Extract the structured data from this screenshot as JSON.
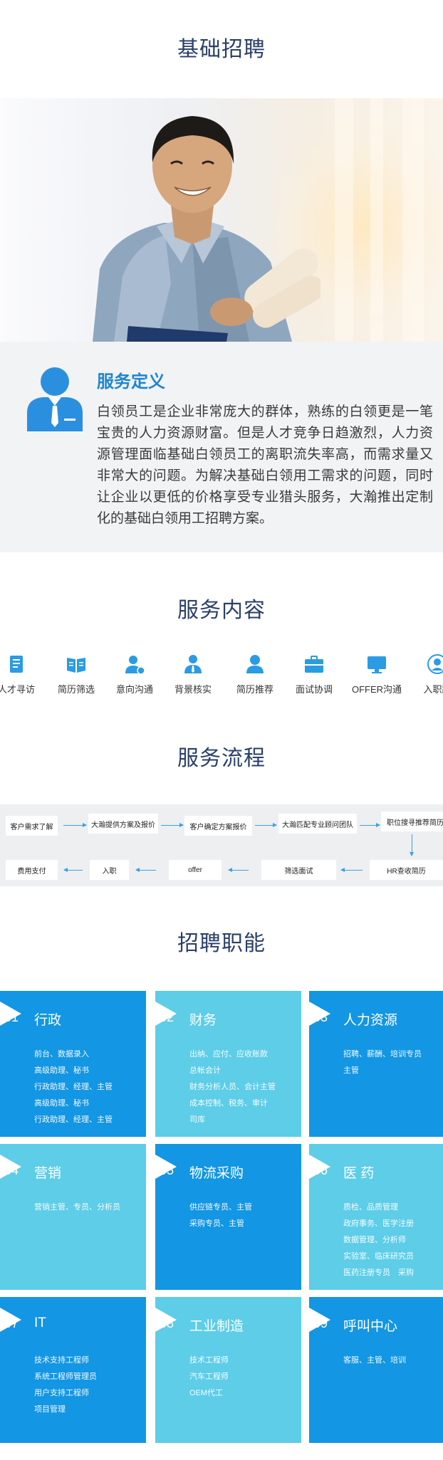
{
  "titles": {
    "basic_recruit": "基础招聘",
    "service_content": "服务内容",
    "service_process": "服务流程",
    "recruit_functions": "招聘职能"
  },
  "definition": {
    "title": "服务定义",
    "text": "白领员工是企业非常庞大的群体，熟练的白领更是一笔宝贵的人力资源财富。但是人才竞争日趋激烈，人力资源管理面临基础白领员工的离职流失率高，而需求量又非常大的问题。为解决基础白领用工需求的问题，同时让企业以更低的价格享受专业猎头服务，大瀚推出定制化的基础白领用工招聘方案。"
  },
  "services": [
    {
      "label": "人才寻访",
      "icon": "document-icon"
    },
    {
      "label": "简历筛选",
      "icon": "book-icon"
    },
    {
      "label": "意向沟通",
      "icon": "user-chat-icon"
    },
    {
      "label": "背景核实",
      "icon": "user-tie-icon"
    },
    {
      "label": "简历推荐",
      "icon": "user-icon"
    },
    {
      "label": "面试协调",
      "icon": "briefcase-icon"
    },
    {
      "label": "OFFER沟通",
      "icon": "monitor-icon"
    },
    {
      "label": "入职跟",
      "icon": "user-circle-icon"
    }
  ],
  "process": {
    "row1": [
      "客户需求了解",
      "大瀚提供方案及报价",
      "客户确定方案报价",
      "大瀚匹配专业顾问团队",
      "职位搜寻推荐简历"
    ],
    "row2": [
      "费用支付",
      "入职",
      "offer",
      "筛选面试",
      "HR查收简历"
    ]
  },
  "functions": [
    {
      "num": "01",
      "name": "行政",
      "tone": "dark",
      "items": [
        "前台、数据录入",
        "高级助理、秘书",
        "行政助理、经理、主管",
        "高级助理、秘书",
        "行政助理、经理、主管"
      ]
    },
    {
      "num": "02",
      "name": "财务",
      "tone": "light",
      "items": [
        "出纳、应付、应收账款",
        "总帐会计",
        "财务分析人员、会计主管",
        "成本控制、税务、审计",
        "司库"
      ]
    },
    {
      "num": "03",
      "name": "人力资源",
      "tone": "dark",
      "items": [
        "招聘、薪酬、培训专员",
        "主管"
      ]
    },
    {
      "num": "04",
      "name": "营销",
      "tone": "light",
      "items": [
        "营销主管、专员、分析员"
      ]
    },
    {
      "num": "05",
      "name": "物流采购",
      "tone": "dark",
      "items": [
        "供应链专员、主管",
        "采购专员、主管"
      ]
    },
    {
      "num": "06",
      "name": "医 药",
      "tone": "light",
      "items": [
        "质检、品质管理",
        "政府事务、医学注册",
        "数据管理、分析师",
        "实验室、临床研究员",
        "医药注册专员　采购"
      ]
    },
    {
      "num": "07",
      "name": "IT",
      "tone": "dark",
      "items": [
        "技术支持工程师",
        "系统工程师管理员",
        "用户支持工程师",
        "项目管理"
      ]
    },
    {
      "num": "08",
      "name": "工业制造",
      "tone": "light",
      "items": [
        "技术工程师",
        "汽车工程师",
        "OEM代工"
      ]
    },
    {
      "num": "09",
      "name": "呼叫中心",
      "tone": "dark",
      "items": [
        "客服、主管、培训"
      ]
    }
  ],
  "colors": {
    "title": "#2a3f6a",
    "accent_blue": "#1396e3",
    "light_blue": "#5dcde8",
    "definition_title": "#1e86d0"
  }
}
